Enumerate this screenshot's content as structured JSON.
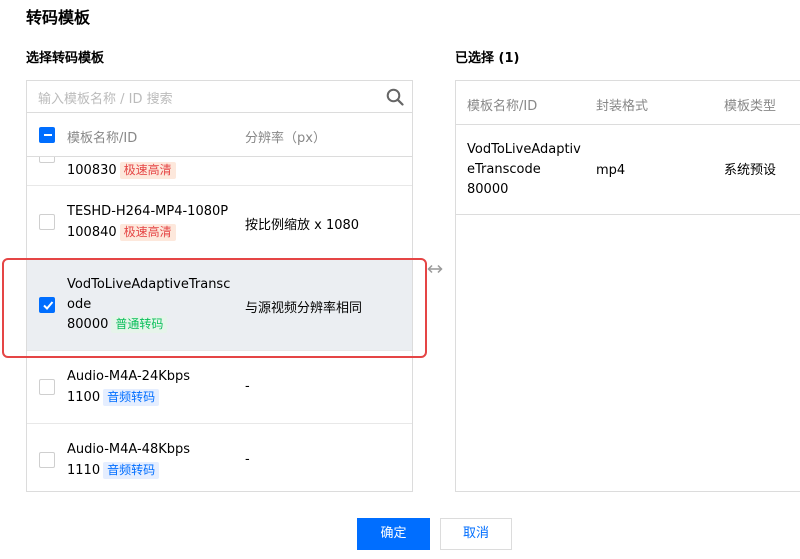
{
  "dialog": {
    "title": "转码模板"
  },
  "left": {
    "label": "选择转码模板",
    "search_placeholder": "输入模板名称 / ID 搜索",
    "col_name": "模板名称/ID",
    "col_res": "分辨率（px）",
    "rows": [
      {
        "name": "",
        "id": "100830",
        "tag": "极速高清",
        "res": "",
        "checked": false
      },
      {
        "name": "TESHD-H264-MP4-1080P",
        "id": "100840",
        "tag": "极速高清",
        "res": "按比例缩放 x 1080",
        "checked": false
      },
      {
        "name1": "VodToLiveAdaptiveTransc",
        "name2": "ode",
        "id": "80000",
        "tag": "普通转码",
        "res": "与源视频分辨率相同",
        "checked": true
      },
      {
        "name": "Audio-M4A-24Kbps",
        "id": "1100",
        "tag": "音频转码",
        "res": "-",
        "checked": false
      },
      {
        "name": "Audio-M4A-48Kbps",
        "id": "1110",
        "tag": "音频转码",
        "res": "-",
        "checked": false
      }
    ]
  },
  "right": {
    "label": "已选择 (1)",
    "col_name": "模板名称/ID",
    "col_format": "封装格式",
    "col_type": "模板类型",
    "row": {
      "name1": "VodToLiveAdaptiv",
      "name2": "eTranscode",
      "id": "80000",
      "format": "mp4",
      "type": "系统预设"
    }
  },
  "buttons": {
    "ok": "确定",
    "cancel": "取消"
  },
  "colors": {
    "accent": "#006eff",
    "highlight": "#e54545"
  }
}
